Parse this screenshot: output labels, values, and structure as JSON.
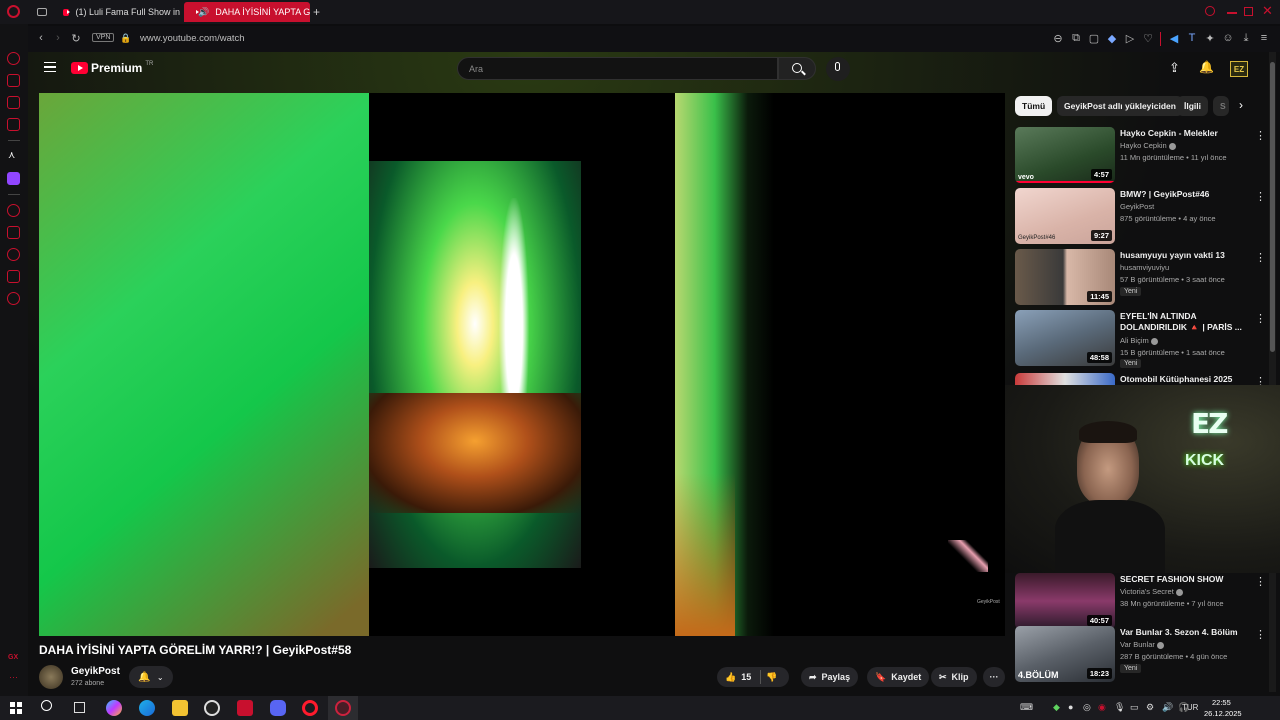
{
  "browser": {
    "tabs": [
      {
        "label": "(1) Luli Fama Full Show in",
        "active": false
      },
      {
        "label": "DAHA İYİSİNİ YAPTA G",
        "active": true
      }
    ],
    "vpn_label": "VPN",
    "url": "www.youtube.com/watch"
  },
  "youtube": {
    "logo_text": "Premium",
    "logo_region": "TR",
    "search_placeholder": "Ara",
    "ez_badge": "EZ"
  },
  "video": {
    "title": "DAHA İYİSİNİ YAPTA GÖRELİM YARR!? | GeyikPost#58",
    "channel": "GeyikPost",
    "subscribers": "272 abone",
    "likes": "15",
    "share_label": "Paylaş",
    "save_label": "Kaydet",
    "clip_label": "Klip",
    "watermark": "GeyikPost"
  },
  "chips": [
    "Tümü",
    "GeyikPost adlı yükleyiciden",
    "İlgili",
    "S"
  ],
  "recommendations": [
    {
      "title": "Hayko Cepkin - Melekler",
      "channel": "Hayko Cepkin",
      "meta": "11 Mn görüntüleme • 11 yıl önce",
      "duration": "4:57",
      "badge": "",
      "thumb_label": "vevo"
    },
    {
      "title": "BMW? | GeyikPost#46",
      "channel": "GeyikPost",
      "meta": "875 görüntüleme • 4 ay önce",
      "duration": "9:27",
      "badge": "",
      "thumb_label": "GeyikPost#46"
    },
    {
      "title": "husamyuyu yayın vakti 13",
      "channel": "husamviyuviyu",
      "meta": "57 B görüntüleme • 3 saat önce",
      "duration": "11:45",
      "badge": "Yeni",
      "thumb_label": ""
    },
    {
      "title": "EYFEL'İN ALTINDA DOLANDIRILDIK 🔺 | PARİS ...",
      "channel": "Ali Biçim",
      "meta": "15 B görüntüleme • 1 saat önce",
      "duration": "48:58",
      "badge": "Yeni",
      "thumb_label": ""
    },
    {
      "title": "Otomobil Kütüphanesi 2025",
      "channel": "",
      "meta": "",
      "duration": "",
      "badge": "",
      "thumb_label": ""
    },
    {
      "title": "SECRET FASHION SHOW",
      "channel": "Victoria's Secret",
      "meta": "38 Mn görüntüleme • 7 yıl önce",
      "duration": "40:57",
      "badge": "",
      "thumb_label": ""
    },
    {
      "title": "Var Bunlar 3. Sezon 4. Bölüm",
      "channel": "Var Bunlar",
      "meta": "287 B görüntüleme • 4 gün önce",
      "duration": "18:23",
      "badge": "Yeni",
      "thumb_label": "4.BÖLÜM"
    }
  ],
  "overlay": {
    "brand": "EZ",
    "platform": "KICK"
  },
  "taskbar": {
    "language": "TUR",
    "time": "22:55",
    "date": "26.12.2025"
  },
  "sidebar_badge": "GX",
  "colors": {
    "accent": "#c8102e",
    "yt_red": "#ff0033",
    "kick_green": "#53fc18"
  }
}
